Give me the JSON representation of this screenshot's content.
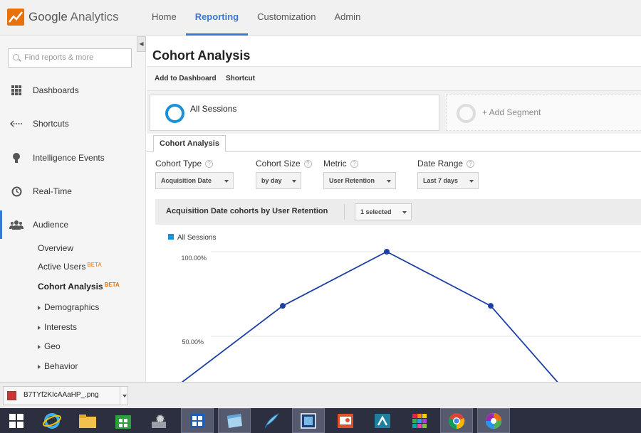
{
  "app": {
    "name_primary": "Google",
    "name_secondary": "Analytics"
  },
  "nav": {
    "home": "Home",
    "reporting": "Reporting",
    "customization": "Customization",
    "admin": "Admin"
  },
  "sidebar": {
    "search_placeholder": "Find reports & more",
    "items": [
      "Dashboards",
      "Shortcuts",
      "Intelligence Events",
      "Real-Time",
      "Audience"
    ],
    "subitems": {
      "overview": "Overview",
      "active_users": "Active Users",
      "cohort": "Cohort Analysis",
      "beta": "BETA",
      "demographics": "Demographics",
      "interests": "Interests",
      "geo": "Geo",
      "behavior": "Behavior"
    }
  },
  "main": {
    "title": "Cohort Analysis",
    "toolbar": {
      "add_dashboard": "Add to Dashboard",
      "shortcut": "Shortcut"
    },
    "segments": {
      "active": "All Sessions",
      "add": "+ Add Segment"
    },
    "tab": "Cohort Analysis",
    "controls": {
      "cohort_type": {
        "label": "Cohort Type",
        "value": "Acquisition Date"
      },
      "cohort_size": {
        "label": "Cohort Size",
        "value": "by day"
      },
      "metric": {
        "label": "Metric",
        "value": "User Retention"
      },
      "date_range": {
        "label": "Date Range",
        "value": "Last 7 days"
      }
    },
    "chart_header": {
      "title": "Acquisition Date cohorts by User Retention",
      "selector": "1 selected"
    },
    "help_glyph": "?"
  },
  "chart_data": {
    "type": "line",
    "series": [
      {
        "name": "All Sessions",
        "color": "#1c3fa8",
        "values": [
          null,
          68,
          100,
          68,
          null
        ]
      }
    ],
    "ylim": [
      0,
      100
    ],
    "yticks": [
      "100.00%",
      "50.00%"
    ],
    "legend_color": "#1d90d6"
  },
  "download": {
    "filename": "B7TYf2KIcAAaHP_.png"
  },
  "colors": {
    "accent": "#3a78d8",
    "beta": "#e8710a"
  }
}
